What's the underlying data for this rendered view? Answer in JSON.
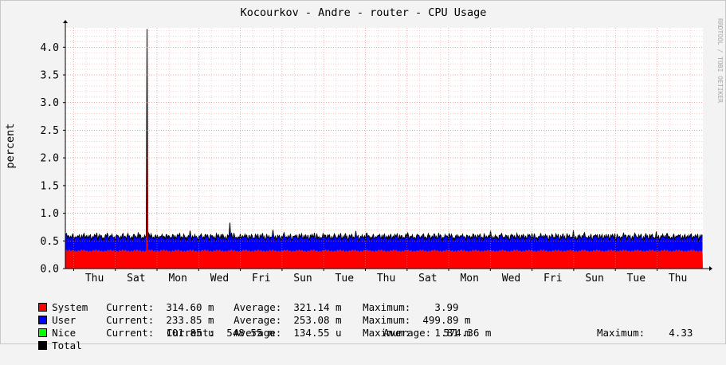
{
  "chart_data": {
    "type": "area",
    "title": "Kocourkov - Andre - router - CPU Usage",
    "ylabel": "percent",
    "watermark": "RRDTOOL / TOBI OETIKER",
    "ylim": [
      0,
      4.35
    ],
    "yticks": [
      "0.0",
      "0.5",
      "1.0",
      "1.5",
      "2.0",
      "2.5",
      "3.0",
      "3.5",
      "4.0"
    ],
    "x_tick_labels": [
      "Thu",
      "Sat",
      "Mon",
      "Wed",
      "Fri",
      "Sun",
      "Tue",
      "Thu",
      "Sat",
      "Mon",
      "Wed",
      "Fri",
      "Sun",
      "Tue",
      "Thu"
    ],
    "stacked": true,
    "series": [
      {
        "name": "System",
        "color": "#ff0000",
        "typical_value": 0.32,
        "spike_position_fraction": 0.128,
        "spike_value": 3.99
      },
      {
        "name": "User",
        "color": "#0000ff",
        "typical_value": 0.25,
        "max_value": 0.5
      },
      {
        "name": "Nice",
        "color": "#00ff00",
        "typical_value": 0.0001
      },
      {
        "name": "Total",
        "color": "#000000",
        "line_only": true,
        "spike_value": 4.33,
        "secondary_spike_fraction": 0.258,
        "secondary_spike_value": 0.83
      }
    ],
    "grid": true
  },
  "legend": {
    "system": {
      "label": "System",
      "current": "Current:  314.60 m",
      "average": "Average:  321.14 m",
      "maximum": "Maximum:    3.99"
    },
    "user": {
      "label": "User",
      "current": "Current:  233.85 m",
      "average": "Average:  253.08 m",
      "maximum": "Maximum:  499.89 m"
    },
    "nice": {
      "label": "Nice",
      "current": "Current:  101.85 u",
      "average": "Average:  134.55 u",
      "maximum": "Maximum:    1.81 m"
    },
    "total": {
      "label": "Total",
      "current": "Current:  548.55 m",
      "average": "Average:  574.36 m",
      "maximum": "Maximum:    4.33"
    }
  }
}
